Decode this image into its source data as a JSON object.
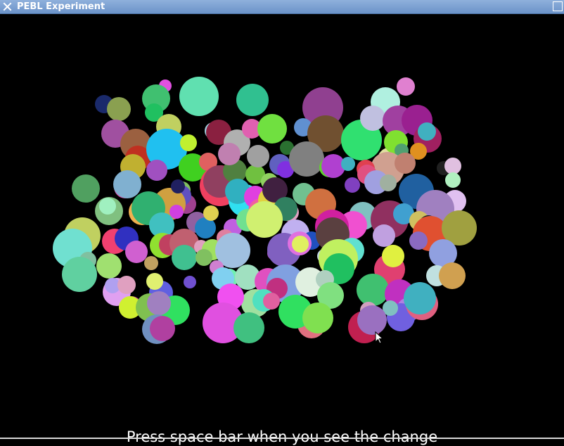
{
  "window": {
    "title": "PEBL Experiment",
    "close_icon": "close-x-icon",
    "titlebar_color": "#7ea3d4"
  },
  "stage": {
    "background": "#000000",
    "instruction": "Press space bar when you see the change"
  },
  "circles": [
    [
      "#1a2a6b",
      148,
      148,
      13
    ],
    [
      "#e050e0",
      235,
      122,
      9
    ],
    [
      "#8aa050",
      169,
      155,
      17
    ],
    [
      "#40c070",
      222,
      140,
      20
    ],
    [
      "#60e0b0",
      283,
      137,
      28
    ],
    [
      "#30c090",
      359,
      142,
      23
    ],
    [
      "#e080d0",
      577,
      123,
      13
    ],
    [
      "#904090",
      459,
      153,
      29
    ],
    [
      "#b0f0e0",
      548,
      145,
      21
    ],
    [
      "#20c060",
      219,
      160,
      13
    ],
    [
      "#c0d060",
      240,
      180,
      18
    ],
    [
      "#a050a0",
      164,
      190,
      20
    ],
    [
      "#9b6040",
      193,
      205,
      22
    ],
    [
      "#c03020",
      196,
      225,
      18
    ],
    [
      "#20c0f0",
      237,
      212,
      29
    ],
    [
      "#c0f030",
      268,
      203,
      12
    ],
    [
      "#a0d0e0",
      303,
      186,
      12
    ],
    [
      "#8a2040",
      311,
      188,
      18
    ],
    [
      "#b0b0b0",
      337,
      203,
      19
    ],
    [
      "#e060b0",
      358,
      183,
      14
    ],
    [
      "#70e040",
      387,
      183,
      21
    ],
    [
      "#6090d0",
      431,
      181,
      13
    ],
    [
      "#2a7030",
      408,
      210,
      10
    ],
    [
      "#705030",
      463,
      190,
      26
    ],
    [
      "#30e070",
      514,
      199,
      29
    ],
    [
      "#c0c0e0",
      530,
      168,
      18
    ],
    [
      "#a040a0",
      566,
      172,
      22
    ],
    [
      "#9a2090",
      593,
      171,
      22
    ],
    [
      "#a02060",
      608,
      197,
      20
    ],
    [
      "#40b0c0",
      607,
      187,
      13
    ],
    [
      "#e0e0a0",
      556,
      229,
      20
    ],
    [
      "#80e030",
      563,
      202,
      17
    ],
    [
      "#e09020",
      595,
      215,
      12
    ],
    [
      "#50a070",
      571,
      214,
      10
    ],
    [
      "#d0a090",
      551,
      240,
      24
    ],
    [
      "#c08070",
      576,
      232,
      15
    ],
    [
      "#e04050",
      520,
      240,
      13
    ],
    [
      "#202020",
      631,
      239,
      10
    ],
    [
      "#e0c0e0",
      644,
      236,
      12
    ],
    [
      "#b0f0c0",
      644,
      256,
      11
    ],
    [
      "#c0b030",
      189,
      237,
      18
    ],
    [
      "#a050c0",
      223,
      242,
      15
    ],
    [
      "#40d020",
      274,
      238,
      20
    ],
    [
      "#e06060",
      296,
      230,
      13
    ],
    [
      "#f04060",
      313,
      264,
      29
    ],
    [
      "#904060",
      312,
      258,
      23
    ],
    [
      "#508040",
      334,
      243,
      17
    ],
    [
      "#c080b0",
      326,
      219,
      16
    ],
    [
      "#70c040",
      363,
      248,
      14
    ],
    [
      "#a0a0a0",
      367,
      222,
      16
    ],
    [
      "#90d060",
      383,
      258,
      12
    ],
    [
      "#6060c0",
      398,
      234,
      15
    ],
    [
      "#8030e0",
      406,
      241,
      12
    ],
    [
      "#808080",
      436,
      226,
      25
    ],
    [
      "#60d030",
      468,
      238,
      14
    ],
    [
      "#b040d0",
      474,
      236,
      17
    ],
    [
      "#40b0c0",
      495,
      233,
      10
    ],
    [
      "#e05080",
      522,
      248,
      14
    ],
    [
      "#8040c0",
      501,
      263,
      11
    ],
    [
      "#a0a0e0",
      535,
      259,
      17
    ],
    [
      "#a0b0a0",
      552,
      260,
      12
    ],
    [
      "#2060a0",
      592,
      272,
      25
    ],
    [
      "#50a060",
      122,
      268,
      20
    ],
    [
      "#e040a0",
      178,
      266,
      16
    ],
    [
      "#80b0d0",
      181,
      262,
      20
    ],
    [
      "#80c060",
      259,
      270,
      12
    ],
    [
      "#a04090",
      265,
      290,
      14
    ],
    [
      "#6050c0",
      257,
      278,
      15
    ],
    [
      "#d0a040",
      241,
      290,
      23
    ],
    [
      "#202060",
      253,
      265,
      10
    ],
    [
      "#30e0f0",
      348,
      285,
      23
    ],
    [
      "#30b0c0",
      338,
      272,
      18
    ],
    [
      "#e040e0",
      363,
      280,
      16
    ],
    [
      "#f060a0",
      371,
      300,
      18
    ],
    [
      "#e0d040",
      384,
      284,
      17
    ],
    [
      "#402040",
      391,
      270,
      18
    ],
    [
      "#70c090",
      432,
      276,
      16
    ],
    [
      "#e0a0c0",
      412,
      302,
      13
    ],
    [
      "#308060",
      406,
      297,
      17
    ],
    [
      "#c05050",
      464,
      298,
      10
    ],
    [
      "#d07040",
      456,
      290,
      22
    ],
    [
      "#80c0c0",
      516,
      307,
      20
    ],
    [
      "#903060",
      554,
      312,
      27
    ],
    [
      "#40a0d0",
      574,
      304,
      15
    ],
    [
      "#e0c0f0",
      647,
      286,
      16
    ],
    [
      "#a080c0",
      619,
      297,
      27
    ],
    [
      "#80c080",
      155,
      300,
      20
    ],
    [
      "#a0f0c0",
      153,
      293,
      12
    ],
    [
      "#f0b050",
      202,
      301,
      19
    ],
    [
      "#30b070",
      211,
      296,
      24
    ],
    [
      "#d040e0",
      251,
      301,
      10
    ],
    [
      "#40c0c0",
      230,
      320,
      18
    ],
    [
      "#9060a0",
      280,
      316,
      15
    ],
    [
      "#2080c0",
      292,
      324,
      15
    ],
    [
      "#e0d050",
      300,
      303,
      11
    ],
    [
      "#c060e0",
      331,
      324,
      13
    ],
    [
      "#70e090",
      352,
      313,
      16
    ],
    [
      "#d0f070",
      376,
      312,
      26
    ],
    [
      "#c0b0f0",
      420,
      332,
      20
    ],
    [
      "#2050c0",
      443,
      342,
      13
    ],
    [
      "#e05060",
      477,
      331,
      15
    ],
    [
      "#f050d0",
      502,
      320,
      20
    ],
    [
      "#d020a0",
      472,
      322,
      24
    ],
    [
      "#5a4040",
      473,
      333,
      24
    ],
    [
      "#c0a0e0",
      546,
      335,
      16
    ],
    [
      "#d0c060",
      596,
      314,
      14
    ],
    [
      "#102020",
      609,
      319,
      13
    ],
    [
      "#e05030",
      612,
      332,
      25
    ],
    [
      "#a0a040",
      653,
      324,
      25
    ],
    [
      "#8a6ac0",
      595,
      342,
      13
    ],
    [
      "#c0d060",
      117,
      335,
      26
    ],
    [
      "#70e0d0",
      103,
      353,
      28
    ],
    [
      "#f04070",
      163,
      343,
      18
    ],
    [
      "#3030c0",
      180,
      339,
      17
    ],
    [
      "#90e030",
      231,
      349,
      18
    ],
    [
      "#d060d0",
      194,
      358,
      16
    ],
    [
      "#c04060",
      241,
      348,
      15
    ],
    [
      "#c06070",
      262,
      346,
      21
    ],
    [
      "#e0a0c0",
      286,
      351,
      10
    ],
    [
      "#a0e060",
      302,
      355,
      15
    ],
    [
      "#e080a0",
      320,
      338,
      12
    ],
    [
      "#a0c0e0",
      331,
      356,
      25
    ],
    [
      "#b050d0",
      390,
      360,
      10
    ],
    [
      "#8060c0",
      404,
      355,
      24
    ],
    [
      "#e070e0",
      426,
      346,
      17
    ],
    [
      "#e0f060",
      427,
      347,
      12
    ],
    [
      "#c0d0e0",
      461,
      364,
      10
    ],
    [
      "#60e0d0",
      500,
      356,
      18
    ],
    [
      "#c0f060",
      481,
      368,
      28
    ],
    [
      "#20c060",
      482,
      382,
      22
    ],
    [
      "#e04070",
      554,
      383,
      22
    ],
    [
      "#e0f040",
      559,
      364,
      16
    ],
    [
      "#90a0e0",
      630,
      360,
      20
    ],
    [
      "#80c0a0",
      125,
      370,
      12
    ],
    [
      "#60d0a0",
      113,
      390,
      25
    ],
    [
      "#a0e070",
      155,
      378,
      18
    ],
    [
      "#c0a060",
      215,
      374,
      10
    ],
    [
      "#40c090",
      262,
      366,
      18
    ],
    [
      "#80c060",
      290,
      366,
      12
    ],
    [
      "#d080d0",
      308,
      380,
      10
    ],
    [
      "#70f0b0",
      326,
      395,
      13
    ],
    [
      "#e0e0a0",
      315,
      400,
      11
    ],
    [
      "#7050d0",
      270,
      401,
      9
    ],
    [
      "#80d0f0",
      317,
      396,
      16
    ],
    [
      "#a0e0c0",
      352,
      394,
      18
    ],
    [
      "#e050c0",
      381,
      400,
      19
    ],
    [
      "#80a0e0",
      406,
      403,
      27
    ],
    [
      "#e0f0e0",
      441,
      401,
      21
    ],
    [
      "#b0d0c0",
      462,
      397,
      13
    ],
    [
      "#80e080",
      470,
      420,
      19
    ],
    [
      "#40c070",
      530,
      412,
      23
    ],
    [
      "#c0e0e0",
      621,
      392,
      15
    ],
    [
      "#d0a050",
      643,
      392,
      19
    ],
    [
      "#c030c0",
      568,
      418,
      21
    ],
    [
      "#e0a0f0",
      166,
      415,
      20
    ],
    [
      "#b0a0f0",
      160,
      406,
      11
    ],
    [
      "#e0a0c0",
      180,
      405,
      13
    ],
    [
      "#6060e0",
      229,
      416,
      17
    ],
    [
      "#e0f070",
      220,
      400,
      12
    ],
    [
      "#a0e0a0",
      363,
      431,
      20
    ],
    [
      "#c03080",
      394,
      410,
      15
    ],
    [
      "#f050f0",
      328,
      422,
      19
    ],
    [
      "#50e0c0",
      375,
      427,
      16
    ],
    [
      "#e060a0",
      386,
      428,
      12
    ],
    [
      "#e07080",
      443,
      461,
      20
    ],
    [
      "#30e060",
      420,
      443,
      24
    ],
    [
      "#80e050",
      452,
      452,
      22
    ],
    [
      "#d0a0c0",
      524,
      441,
      12
    ],
    [
      "#b080e0",
      581,
      440,
      17
    ],
    [
      "#7060e0",
      570,
      451,
      20
    ],
    [
      "#80c0c0",
      555,
      438,
      11
    ],
    [
      "#e06080",
      600,
      432,
      23
    ],
    [
      "#40b0c0",
      597,
      424,
      23
    ],
    [
      "#c030a0",
      187,
      436,
      15
    ],
    [
      "#d0f030",
      185,
      437,
      16
    ],
    [
      "#80c050",
      213,
      437,
      20
    ],
    [
      "#30e060",
      249,
      441,
      21
    ],
    [
      "#a080c0",
      226,
      431,
      17
    ],
    [
      "#7090c0",
      223,
      468,
      21
    ],
    [
      "#b040a0",
      231,
      467,
      18
    ],
    [
      "#e050e0",
      317,
      459,
      29
    ],
    [
      "#20f0e0",
      355,
      465,
      17
    ],
    [
      "#40c080",
      354,
      466,
      22
    ],
    [
      "#c02050",
      518,
      465,
      23
    ],
    [
      "#9a70c0",
      529,
      455,
      21
    ]
  ]
}
